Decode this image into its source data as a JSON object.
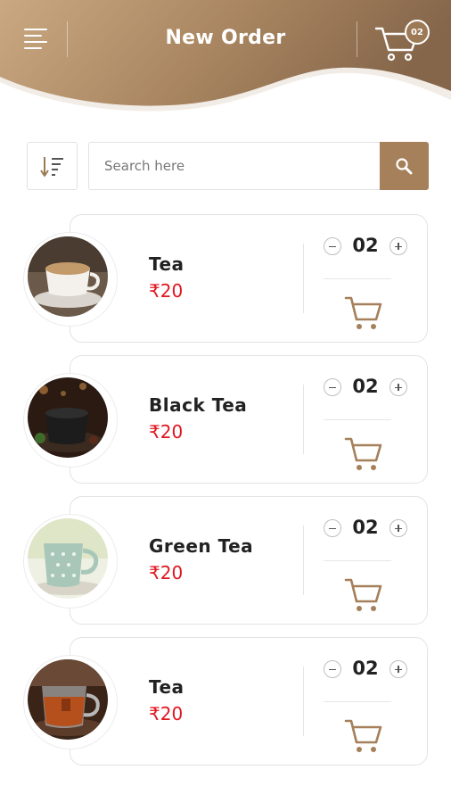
{
  "header": {
    "title": "New Order",
    "cart_count": "02",
    "menu_icon": "hamburger-menu-icon",
    "cart_icon": "shopping-cart-icon",
    "gradient_start": "#c5a47e",
    "gradient_end": "#8a6a49"
  },
  "search": {
    "placeholder": "Search here",
    "value": "",
    "sort_icon": "sort-icon",
    "search_icon": "magnifier-icon",
    "button_color": "#a5805a"
  },
  "products": [
    {
      "name": "Tea",
      "price": "₹20",
      "quantity": "02",
      "image": "tea-cup-image"
    },
    {
      "name": "Black Tea",
      "price": "₹20",
      "quantity": "02",
      "image": "black-tea-image"
    },
    {
      "name": "Green Tea",
      "price": "₹20",
      "quantity": "02",
      "image": "green-tea-image"
    },
    {
      "name": "Tea",
      "price": "₹20",
      "quantity": "02",
      "image": "glass-tea-image"
    }
  ],
  "colors": {
    "accent": "#a5805a",
    "price": "#e0161f",
    "card_border": "#e3e3e3"
  }
}
